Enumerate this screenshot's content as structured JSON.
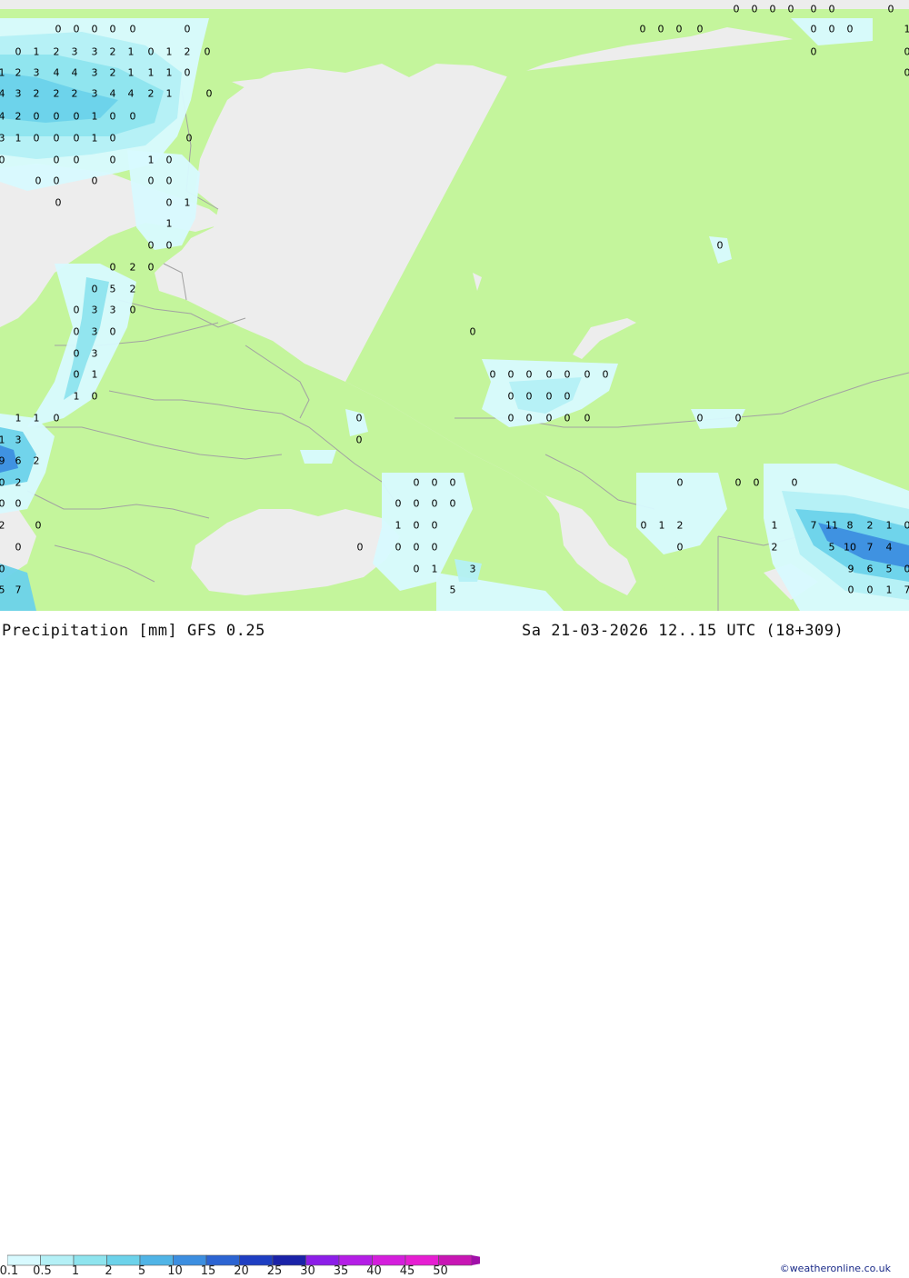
{
  "title": "Precipitation [mm]",
  "model": "GFS 0.25",
  "datetime": "Sa 21-03-2026 12..15 UTC (18+309)",
  "credit": "©weatheronline.co.uk",
  "legend": {
    "labels": [
      "0.1",
      "0.5",
      "1",
      "2",
      "5",
      "10",
      "15",
      "20",
      "25",
      "30",
      "35",
      "40",
      "45",
      "50"
    ],
    "colors": [
      "#d8faff",
      "#b4f0f6",
      "#8ee4ee",
      "#6cd2ea",
      "#50b4e6",
      "#3c8ee0",
      "#2c64d2",
      "#1e3ec2",
      "#1a22a8",
      "#8c1ee8",
      "#b41ee6",
      "#d41edc",
      "#e61ed2",
      "#c816b4"
    ]
  },
  "map_colors": {
    "land": "#c4f59c",
    "sea": "#ededed",
    "border": "#a2a2a2"
  },
  "values": [
    "0",
    "0",
    "0",
    "0",
    "0",
    "0",
    "0",
    "0",
    "0",
    "0",
    "0",
    "0",
    "0",
    "0",
    "0",
    "0",
    "0",
    "0",
    "0",
    "0",
    "0",
    "1",
    "2",
    "3",
    "3",
    "2",
    "1",
    "0",
    "1",
    "2",
    "0",
    "0",
    "1",
    "0",
    "0",
    "1",
    "2",
    "3",
    "4",
    "4",
    "3",
    "2",
    "1",
    "1",
    "1",
    "0",
    "4",
    "3",
    "2",
    "2",
    "2",
    "3",
    "4",
    "4",
    "2",
    "1",
    "0",
    "4",
    "2",
    "0",
    "0",
    "0",
    "1",
    "0",
    "0",
    "3",
    "1",
    "0",
    "0",
    "0",
    "1",
    "0",
    "0",
    "0",
    "0",
    "0",
    "0",
    "1",
    "0",
    "0",
    "0",
    "0",
    "0",
    "0",
    "0",
    "1",
    "0",
    "1",
    "0",
    "0",
    "0",
    "2",
    "0",
    "0",
    "5",
    "2",
    "0",
    "3",
    "3",
    "0",
    "0",
    "3",
    "0",
    "0",
    "3",
    "0",
    "1",
    "1",
    "0",
    "0",
    "0",
    "0",
    "0",
    "0",
    "0",
    "0",
    "0",
    "0",
    "0",
    "0",
    "0",
    "0",
    "0",
    "0",
    "0",
    "0",
    "0",
    "0",
    "1",
    "1",
    "0",
    "0",
    "0",
    "0",
    "0",
    "0",
    "1",
    "3",
    "9",
    "6",
    "2",
    "0",
    "2",
    "0",
    "0",
    "0",
    "0",
    "0",
    "0",
    "0",
    "0",
    "0",
    "0",
    "0",
    "2",
    "0",
    "1",
    "0",
    "0",
    "0",
    "1",
    "2",
    "1",
    "7",
    "11",
    "8",
    "2",
    "1",
    "0",
    "0",
    "0",
    "0",
    "0",
    "0",
    "0",
    "2",
    "5",
    "10",
    "7",
    "4",
    "0",
    "1",
    "3",
    "0",
    "5",
    "7",
    "9",
    "6",
    "5",
    "0",
    "0",
    "0",
    "1",
    "7",
    "5"
  ]
}
